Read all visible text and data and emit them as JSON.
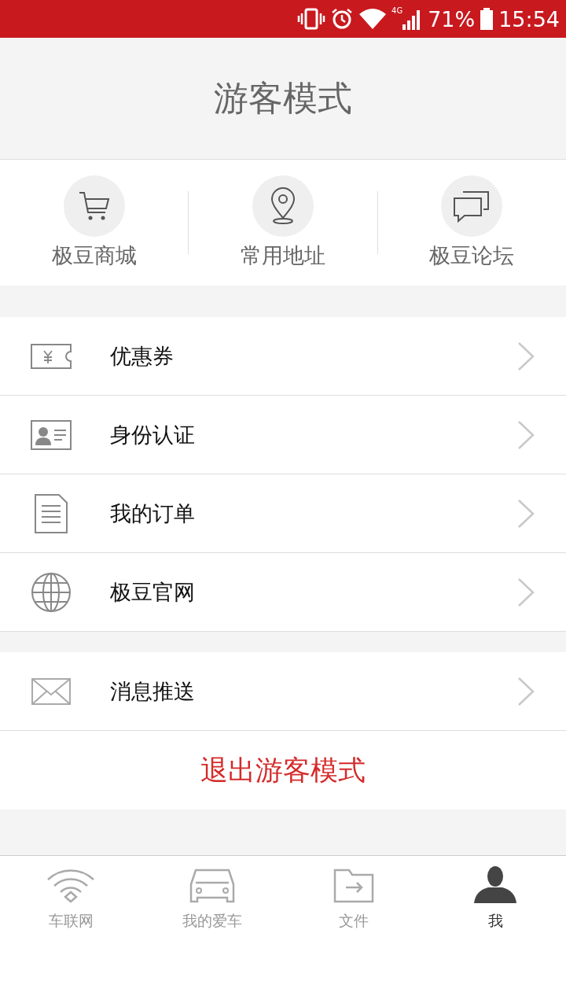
{
  "status_bar": {
    "network": "4G",
    "battery": "71%",
    "time": "15:54"
  },
  "header": {
    "title": "游客模式"
  },
  "shortcuts": [
    {
      "label": "极豆商城",
      "kind": "cart"
    },
    {
      "label": "常用地址",
      "kind": "pin"
    },
    {
      "label": "极豆论坛",
      "kind": "chat"
    }
  ],
  "menu_groups": [
    [
      {
        "label": "优惠券",
        "kind": "coupon"
      },
      {
        "label": "身份认证",
        "kind": "id"
      },
      {
        "label": "我的订单",
        "kind": "doc"
      },
      {
        "label": "极豆官网",
        "kind": "globe"
      }
    ],
    [
      {
        "label": "消息推送",
        "kind": "mail"
      }
    ]
  ],
  "logout_button": "退出游客模式",
  "tabs": [
    {
      "label": "车联网",
      "kind": "wifi",
      "selected": false
    },
    {
      "label": "我的爱车",
      "kind": "car",
      "selected": false
    },
    {
      "label": "文件",
      "kind": "folder",
      "selected": false
    },
    {
      "label": "我",
      "kind": "person",
      "selected": true
    }
  ]
}
